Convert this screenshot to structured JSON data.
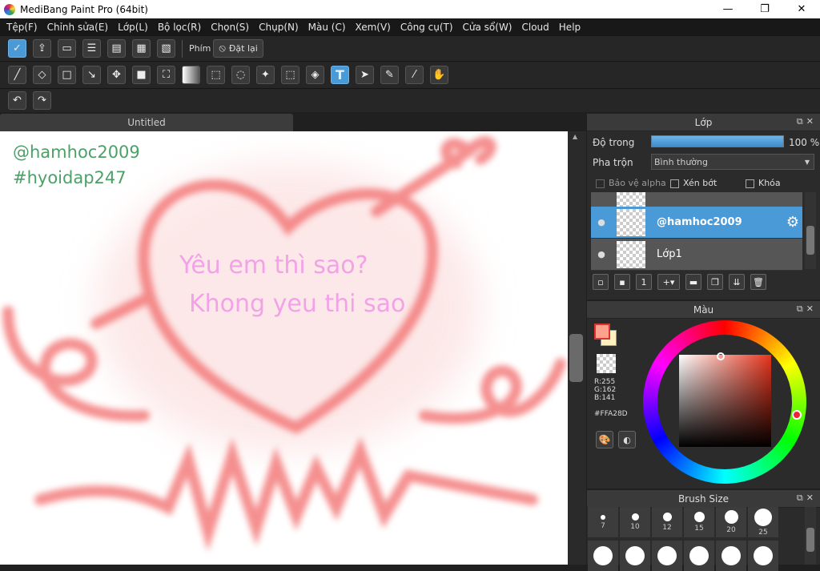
{
  "window": {
    "title": "MediBang Paint Pro (64bit)",
    "minimize": "—",
    "maximize": "❐",
    "close": "✕"
  },
  "menu": [
    "Tệp(F)",
    "Chỉnh sửa(E)",
    "Lớp(L)",
    "Bộ lọc(R)",
    "Chọn(S)",
    "Chụp(N)",
    "Màu (C)",
    "Xem(V)",
    "Công cụ(T)",
    "Cửa sổ(W)",
    "Cloud",
    "Help"
  ],
  "toolbar1": {
    "shortcut_label": "Phím",
    "reset_label": "Đặt lại"
  },
  "document": {
    "tab": "Untitled"
  },
  "canvas": {
    "watermark1": "@hamhoc2009",
    "watermark2": "#hyoidap247",
    "text1": "Yêu em thì sao?",
    "text2": "Khong yeu thi sao"
  },
  "layers": {
    "title": "Lớp",
    "opacity_label": "Độ trong",
    "opacity_value": "100 %",
    "opacity": 1.0,
    "blend_label": "Pha trộn",
    "blend_value": "Bình thường",
    "protect_alpha": "Bảo vệ alpha",
    "clipping": "Xén bớt",
    "lock": "Khóa",
    "items": [
      {
        "name": "@hamhoc2009",
        "selected": true
      },
      {
        "name": "Lớp1",
        "selected": false
      }
    ]
  },
  "color": {
    "title": "Màu",
    "r": "R:255",
    "g": "G:162",
    "b": "B:141",
    "hex": "#FFA28D",
    "fg": "#FFA28D",
    "bg": "#FFF0C0"
  },
  "brush": {
    "title": "Brush Size",
    "sizes": [
      "7",
      "10",
      "12",
      "15",
      "20",
      "25"
    ]
  },
  "colors": {
    "accent": "#4A9AD8",
    "heart": "#F26A6A",
    "pinkText": "#F2A2E6",
    "watermark": "#2E8F4E"
  }
}
